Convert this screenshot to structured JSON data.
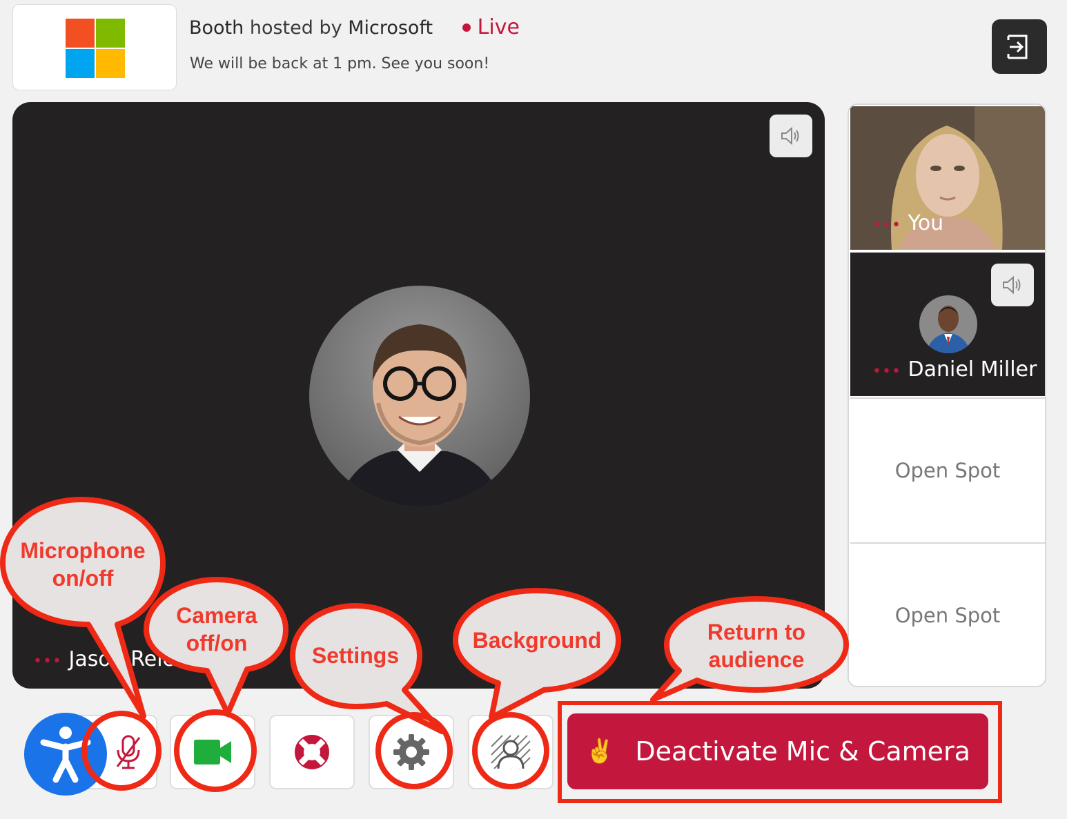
{
  "header": {
    "booth_word": "Booth",
    "hosted_by": "hosted by",
    "host": "Microsoft",
    "live": "Live",
    "subtitle": "We will be back at 1 pm. See you soon!"
  },
  "brand": {
    "logo": [
      "#f25022",
      "#7fba00",
      "#00a4ef",
      "#ffb900"
    ],
    "accent": "#c4173d",
    "callout": "#ef3a2c"
  },
  "stage": {
    "speaker_name": "Jason Reich",
    "dots": "•••"
  },
  "side": {
    "you_label": "You",
    "daniel_label": "Daniel Miller",
    "open_spots": [
      "Open Spot",
      "Open Spot"
    ],
    "dots": "•••"
  },
  "toolbar": {
    "deactivate_emoji": "✌️",
    "deactivate_label": "Deactivate Mic & Camera"
  },
  "callouts": {
    "microphone": [
      "Microphone",
      "on/off"
    ],
    "camera": [
      "Camera",
      "off/on"
    ],
    "settings": "Settings",
    "background": "Background",
    "return": [
      "Return to",
      "audience"
    ]
  }
}
